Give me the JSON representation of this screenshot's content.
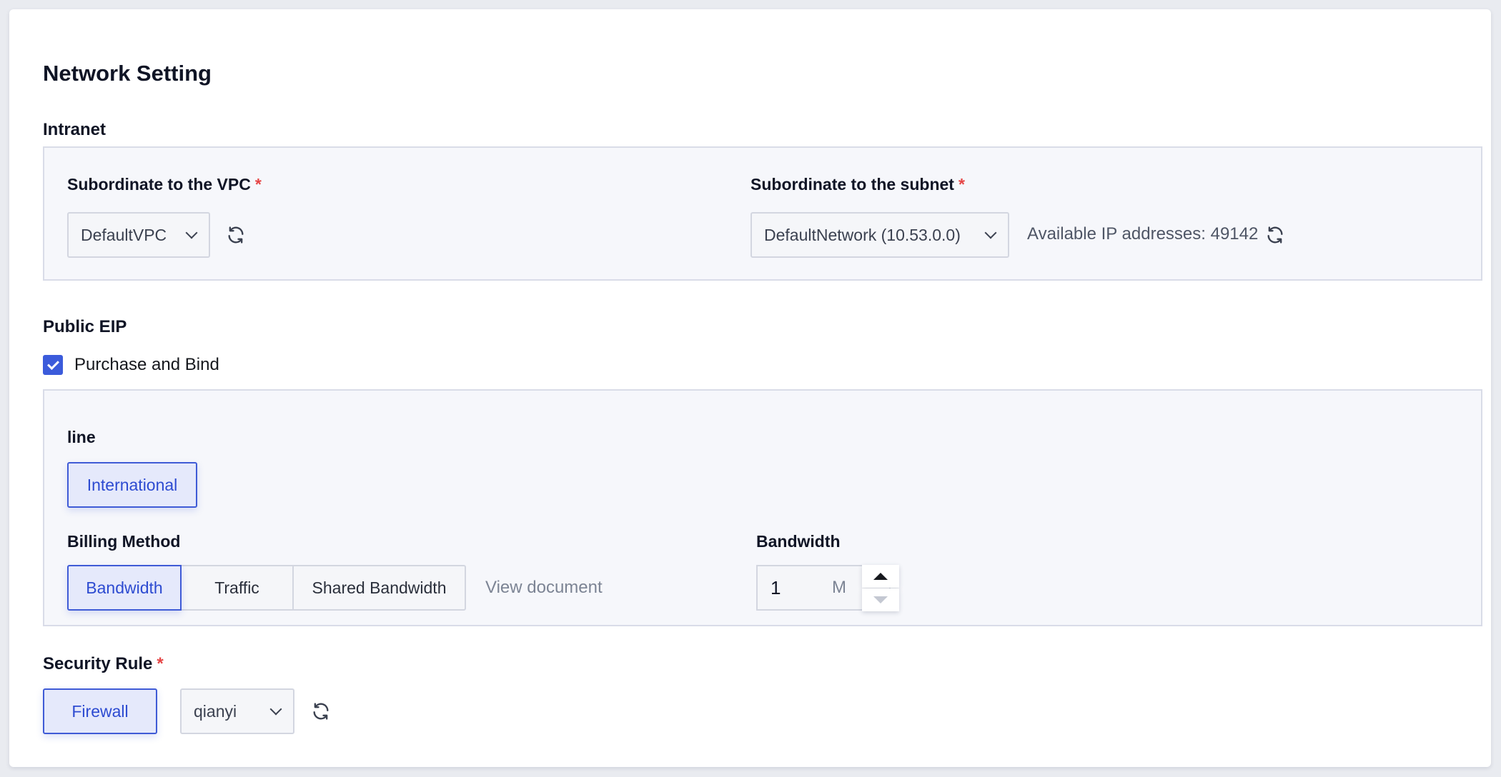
{
  "page": {
    "title": "Network Setting"
  },
  "intranet": {
    "label": "Intranet",
    "vpc": {
      "label": "Subordinate to the VPC",
      "required_mark": "*",
      "value": "DefaultVPC"
    },
    "subnet": {
      "label": "Subordinate to the subnet",
      "required_mark": "*",
      "value": "DefaultNetwork (10.53.0.0)",
      "available_ip_text": "Available IP addresses: 49142"
    }
  },
  "public_eip": {
    "label": "Public EIP",
    "purchase_checkbox": {
      "label": "Purchase and Bind",
      "checked": true
    },
    "line": {
      "label": "line",
      "options": [
        "International"
      ],
      "selected": "International"
    },
    "billing": {
      "label": "Billing Method",
      "options": [
        "Bandwidth",
        "Traffic",
        "Shared Bandwidth"
      ],
      "selected": "Bandwidth",
      "doc_link": "View document"
    },
    "bandwidth": {
      "label": "Bandwidth",
      "value": "1",
      "unit": "M"
    }
  },
  "security": {
    "label": "Security Rule",
    "required_mark": "*",
    "type_button": "Firewall",
    "rule_value": "qianyi"
  },
  "colors": {
    "accent": "#3b5bdb",
    "required": "#e54545",
    "panel_bg": "#f6f7fb"
  },
  "icons": {
    "refresh": "refresh-icon",
    "dropdown": "chevron-down-icon",
    "check": "check-icon"
  }
}
